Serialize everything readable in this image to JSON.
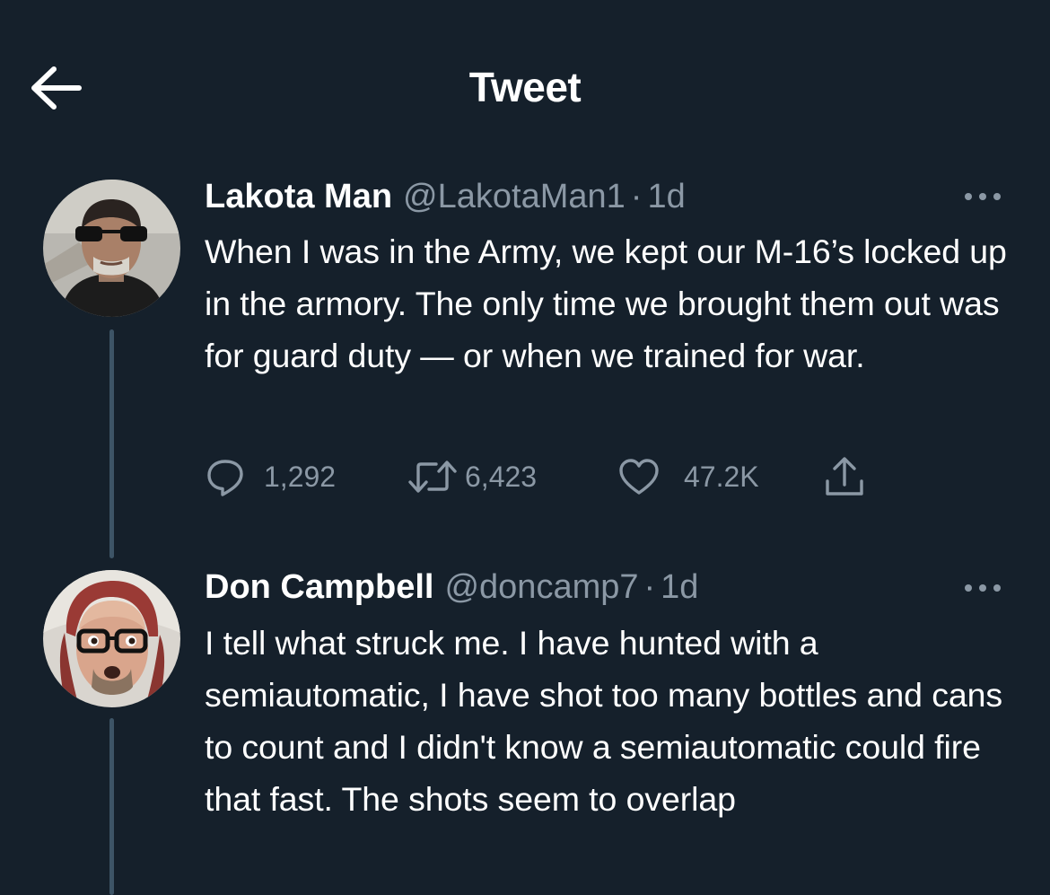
{
  "header": {
    "title": "Tweet",
    "back_icon": "arrow-left-icon"
  },
  "tweets": [
    {
      "display_name": "Lakota Man",
      "handle": "@LakotaMan1",
      "separator": "·",
      "time": "1d",
      "text": "When I was in the Army, we kept our M-16’s locked up in the armory. The only time we brought them out was for guard duty — or when we trained for war.",
      "stats": {
        "replies": "1,292",
        "retweets": "6,423",
        "likes": "47.2K"
      }
    },
    {
      "display_name": "Don Campbell",
      "handle": "@doncamp7",
      "separator": "·",
      "time": "1d",
      "text": "I tell what struck me. I have hunted with a semiautomatic, I have shot too many bottles and cans to count and I didn't know a semiautomatic could fire that fast. The shots seem to overlap"
    }
  ],
  "colors": {
    "background": "#15202b",
    "primary_text": "#ffffff",
    "secondary_text": "#8b98a5",
    "thread_line": "#3d5466"
  }
}
